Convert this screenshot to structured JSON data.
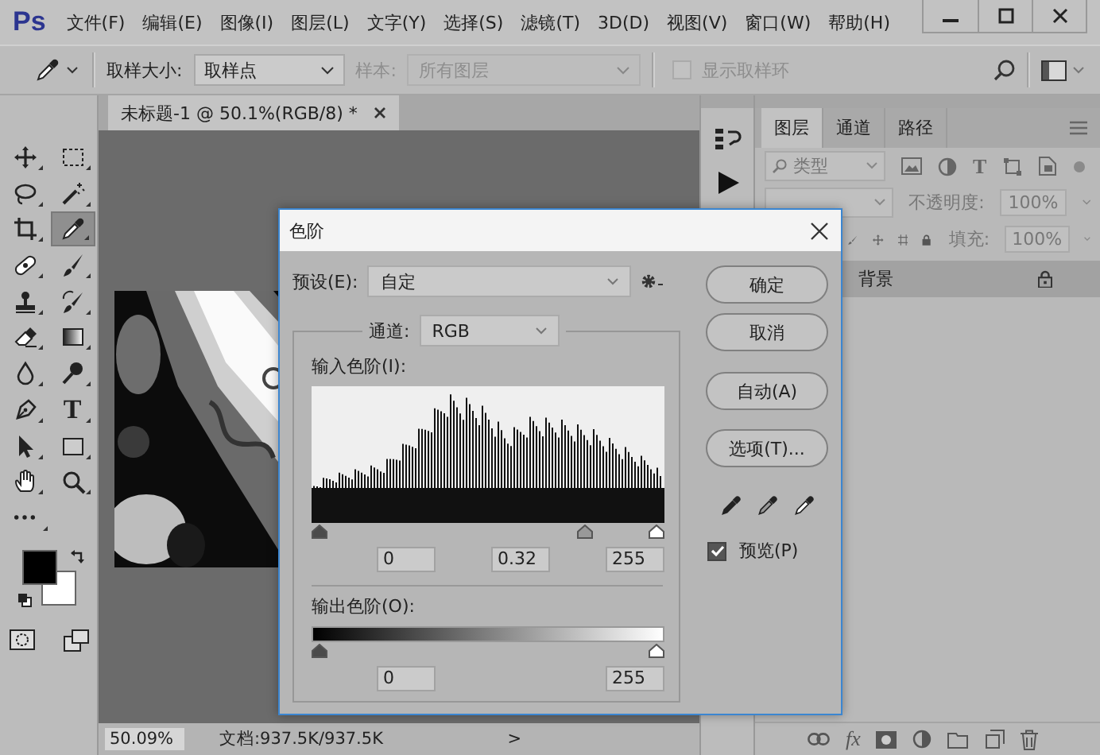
{
  "app": {
    "logo": "Ps"
  },
  "menu": [
    "文件(F)",
    "编辑(E)",
    "图像(I)",
    "图层(L)",
    "文字(Y)",
    "选择(S)",
    "滤镜(T)",
    "3D(D)",
    "视图(V)",
    "窗口(W)",
    "帮助(H)"
  ],
  "options_bar": {
    "sample_size_label": "取样大小:",
    "sample_size": "取样点",
    "sample_label": "样本:",
    "sample": "所有图层",
    "sample_disabled": true,
    "show_ring": {
      "label": "显示取样环",
      "checked": false,
      "disabled": true
    }
  },
  "document": {
    "tab": "未标题-1 @ 50.1%(RGB/8) *",
    "zoom": "50.09%",
    "doc_info": "文档:937.5K/937.5K",
    "more": ">"
  },
  "tools": [
    {
      "kind": "move",
      "selected": false
    },
    {
      "kind": "marquee",
      "selected": false
    },
    {
      "kind": "lasso",
      "selected": false
    },
    {
      "kind": "wand",
      "selected": false
    },
    {
      "kind": "crop",
      "selected": false
    },
    {
      "kind": "eyedropper",
      "selected": true
    },
    {
      "kind": "healing",
      "selected": false
    },
    {
      "kind": "brush",
      "selected": false
    },
    {
      "kind": "stamp",
      "selected": false
    },
    {
      "kind": "history-brush",
      "selected": false
    },
    {
      "kind": "eraser",
      "selected": false
    },
    {
      "kind": "gradient",
      "selected": false
    },
    {
      "kind": "blur",
      "selected": false
    },
    {
      "kind": "dodge",
      "selected": false
    },
    {
      "kind": "pen",
      "selected": false
    },
    {
      "kind": "type",
      "selected": false,
      "glyph": "T"
    },
    {
      "kind": "path-select",
      "selected": false
    },
    {
      "kind": "rectangle",
      "selected": false
    },
    {
      "kind": "hand",
      "selected": false
    },
    {
      "kind": "zoom",
      "selected": false
    },
    {
      "kind": "more",
      "selected": false
    }
  ],
  "layers_panel": {
    "tabs": [
      {
        "label": "图层",
        "selected": true
      },
      {
        "label": "通道",
        "selected": false
      },
      {
        "label": "路径",
        "selected": false
      }
    ],
    "filter": "类型",
    "type_filter_glyph": "T",
    "opacity_label": "不透明度:",
    "opacity": "100%",
    "fill_label": "填充:",
    "fill": "100%",
    "fx": "fx",
    "layers": [
      {
        "name": "背景",
        "selected": true,
        "locked": true
      }
    ]
  },
  "levels_dialog": {
    "title": "色阶",
    "preset_label": "预设(E):",
    "preset": "自定",
    "channel_label": "通道:",
    "channel": "RGB",
    "input_label": "输入色阶(I):",
    "input_thumbs": [
      {
        "kind": "black",
        "level": 0
      },
      {
        "kind": "gray",
        "level": 0.79
      },
      {
        "kind": "white",
        "level": 1
      }
    ],
    "input_values": [
      "0",
      "0.32",
      "255"
    ],
    "output_label": "输出色阶(O):",
    "output_thumbs": [
      {
        "kind": "black",
        "level": 0
      },
      {
        "kind": "white",
        "level": 1
      }
    ],
    "output_values": [
      "0",
      "255"
    ],
    "buttons": [
      "确定",
      "取消",
      "自动(A)",
      "选项(T)..."
    ],
    "preview": {
      "label": "预览(P)",
      "checked": true
    }
  }
}
